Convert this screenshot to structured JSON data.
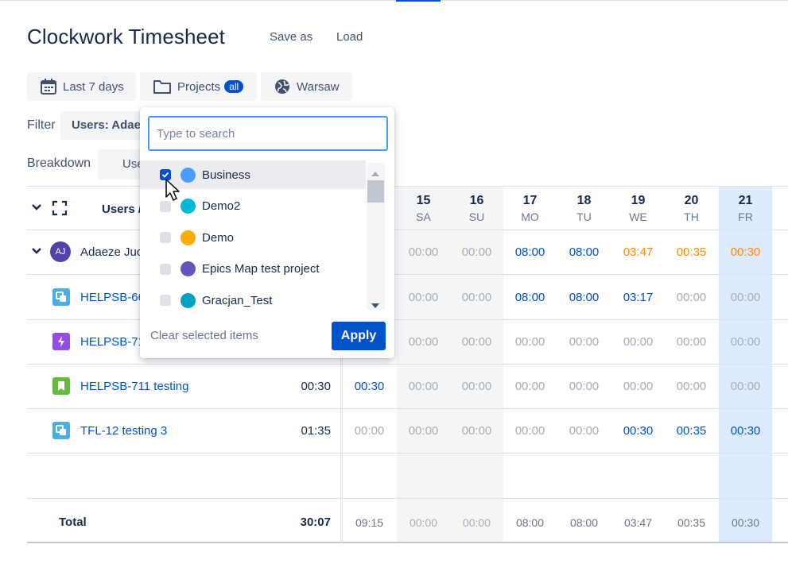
{
  "header": {
    "title": "Clockwork Timesheet",
    "save_as": "Save as",
    "load": "Load"
  },
  "toolbar": {
    "date_range": "Last 7 days",
    "projects": "Projects",
    "projects_badge": "all",
    "timezone": "Warsaw"
  },
  "filter": {
    "label": "Filter",
    "chip": "Users: Adaeze"
  },
  "breakdown": {
    "label": "Breakdown",
    "chip": "Users"
  },
  "table": {
    "name_header": "Users /",
    "days": [
      {
        "num": "15",
        "wd": "SA"
      },
      {
        "num": "16",
        "wd": "SU"
      },
      {
        "num": "17",
        "wd": "MO"
      },
      {
        "num": "18",
        "wd": "TU"
      },
      {
        "num": "19",
        "wd": "WE"
      },
      {
        "num": "20",
        "wd": "TH"
      },
      {
        "num": "21",
        "wd": "FR"
      }
    ],
    "rows": [
      {
        "name": "Adaeze Juc",
        "total": "",
        "first": "",
        "cells": [
          "00:00",
          "00:00",
          "08:00",
          "08:00",
          "03:47",
          "00:35",
          "00:30"
        ]
      },
      {
        "name": "HELPSB-66",
        "total": "",
        "first": "",
        "cells": [
          "00:00",
          "00:00",
          "08:00",
          "08:00",
          "03:17",
          "00:00",
          "00:00"
        ]
      },
      {
        "name": "HELPSB-71",
        "total": "",
        "first": "",
        "cells": [
          "00:00",
          "00:00",
          "00:00",
          "00:00",
          "00:00",
          "00:00",
          "00:00"
        ]
      },
      {
        "name": "HELPSB-711 testing",
        "total": "00:30",
        "first": "00:30",
        "cells": [
          "00:00",
          "00:00",
          "00:00",
          "00:00",
          "00:00",
          "00:00",
          "00:00"
        ]
      },
      {
        "name": "TFL-12 testing 3",
        "total": "01:35",
        "first": "00:00",
        "cells": [
          "00:00",
          "00:00",
          "00:00",
          "00:00",
          "00:30",
          "00:35",
          "00:30"
        ]
      }
    ],
    "totals": {
      "label": "Total",
      "total": "30:07",
      "first": "09:15",
      "cells": [
        "00:00",
        "00:00",
        "08:00",
        "08:00",
        "03:47",
        "00:35",
        "00:30"
      ]
    }
  },
  "dropdown": {
    "search_placeholder": "Type to search",
    "options": [
      {
        "label": "Business",
        "checked": true,
        "color": "#4c9aff"
      },
      {
        "label": "Demo2",
        "checked": false,
        "color": "#00b8d9"
      },
      {
        "label": "Demo",
        "checked": false,
        "color": "#ffab00"
      },
      {
        "label": "Epics Map test project",
        "checked": false,
        "color": "#6554c0"
      },
      {
        "label": "Gracjan_Test",
        "checked": false,
        "color": "#00a3bf"
      }
    ],
    "clear_label": "Clear selected items",
    "apply_label": "Apply"
  },
  "colors": {
    "accent": "#0052cc",
    "highlight_column": "#deebff",
    "weekend": "#f4f5f7",
    "overtime": "#ff8b00"
  }
}
